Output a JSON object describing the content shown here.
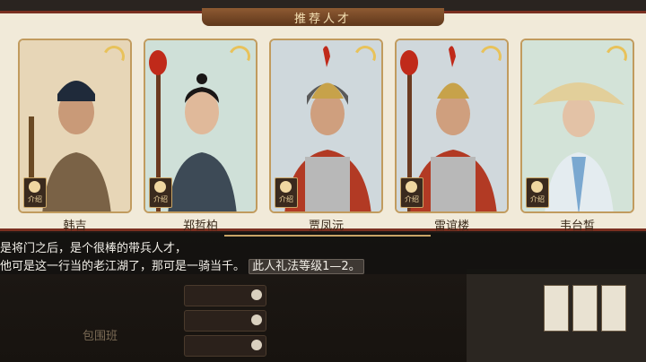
{
  "panel": {
    "title": "推荐人才"
  },
  "cards": [
    {
      "name": "韩吉",
      "badge": "介绍",
      "bg": "#e7d6b7",
      "accent": "#6a4a2a"
    },
    {
      "name": "郑哲柏",
      "badge": "介绍",
      "bg": "#cfe0d8",
      "accent": "#2d2a28"
    },
    {
      "name": "贾凤沅",
      "badge": "介绍",
      "bg": "#cfd8dc",
      "accent": "#a8382a"
    },
    {
      "name": "雷谊楼",
      "badge": "介绍",
      "bg": "#d0d8dc",
      "accent": "#a8382a"
    },
    {
      "name": "韦台皙",
      "badge": "介绍",
      "bg": "#d3e3d8",
      "accent": "#d8c89a"
    }
  ],
  "dialog": {
    "line1": "是将门之后，是个很棒的带兵人才，",
    "line2_prefix": "他可是这一行当的老江湖了，那可是一骑当千。",
    "line2_highlight": "此人礼法等级1—2。"
  },
  "bottom": {
    "label": "包围班"
  }
}
